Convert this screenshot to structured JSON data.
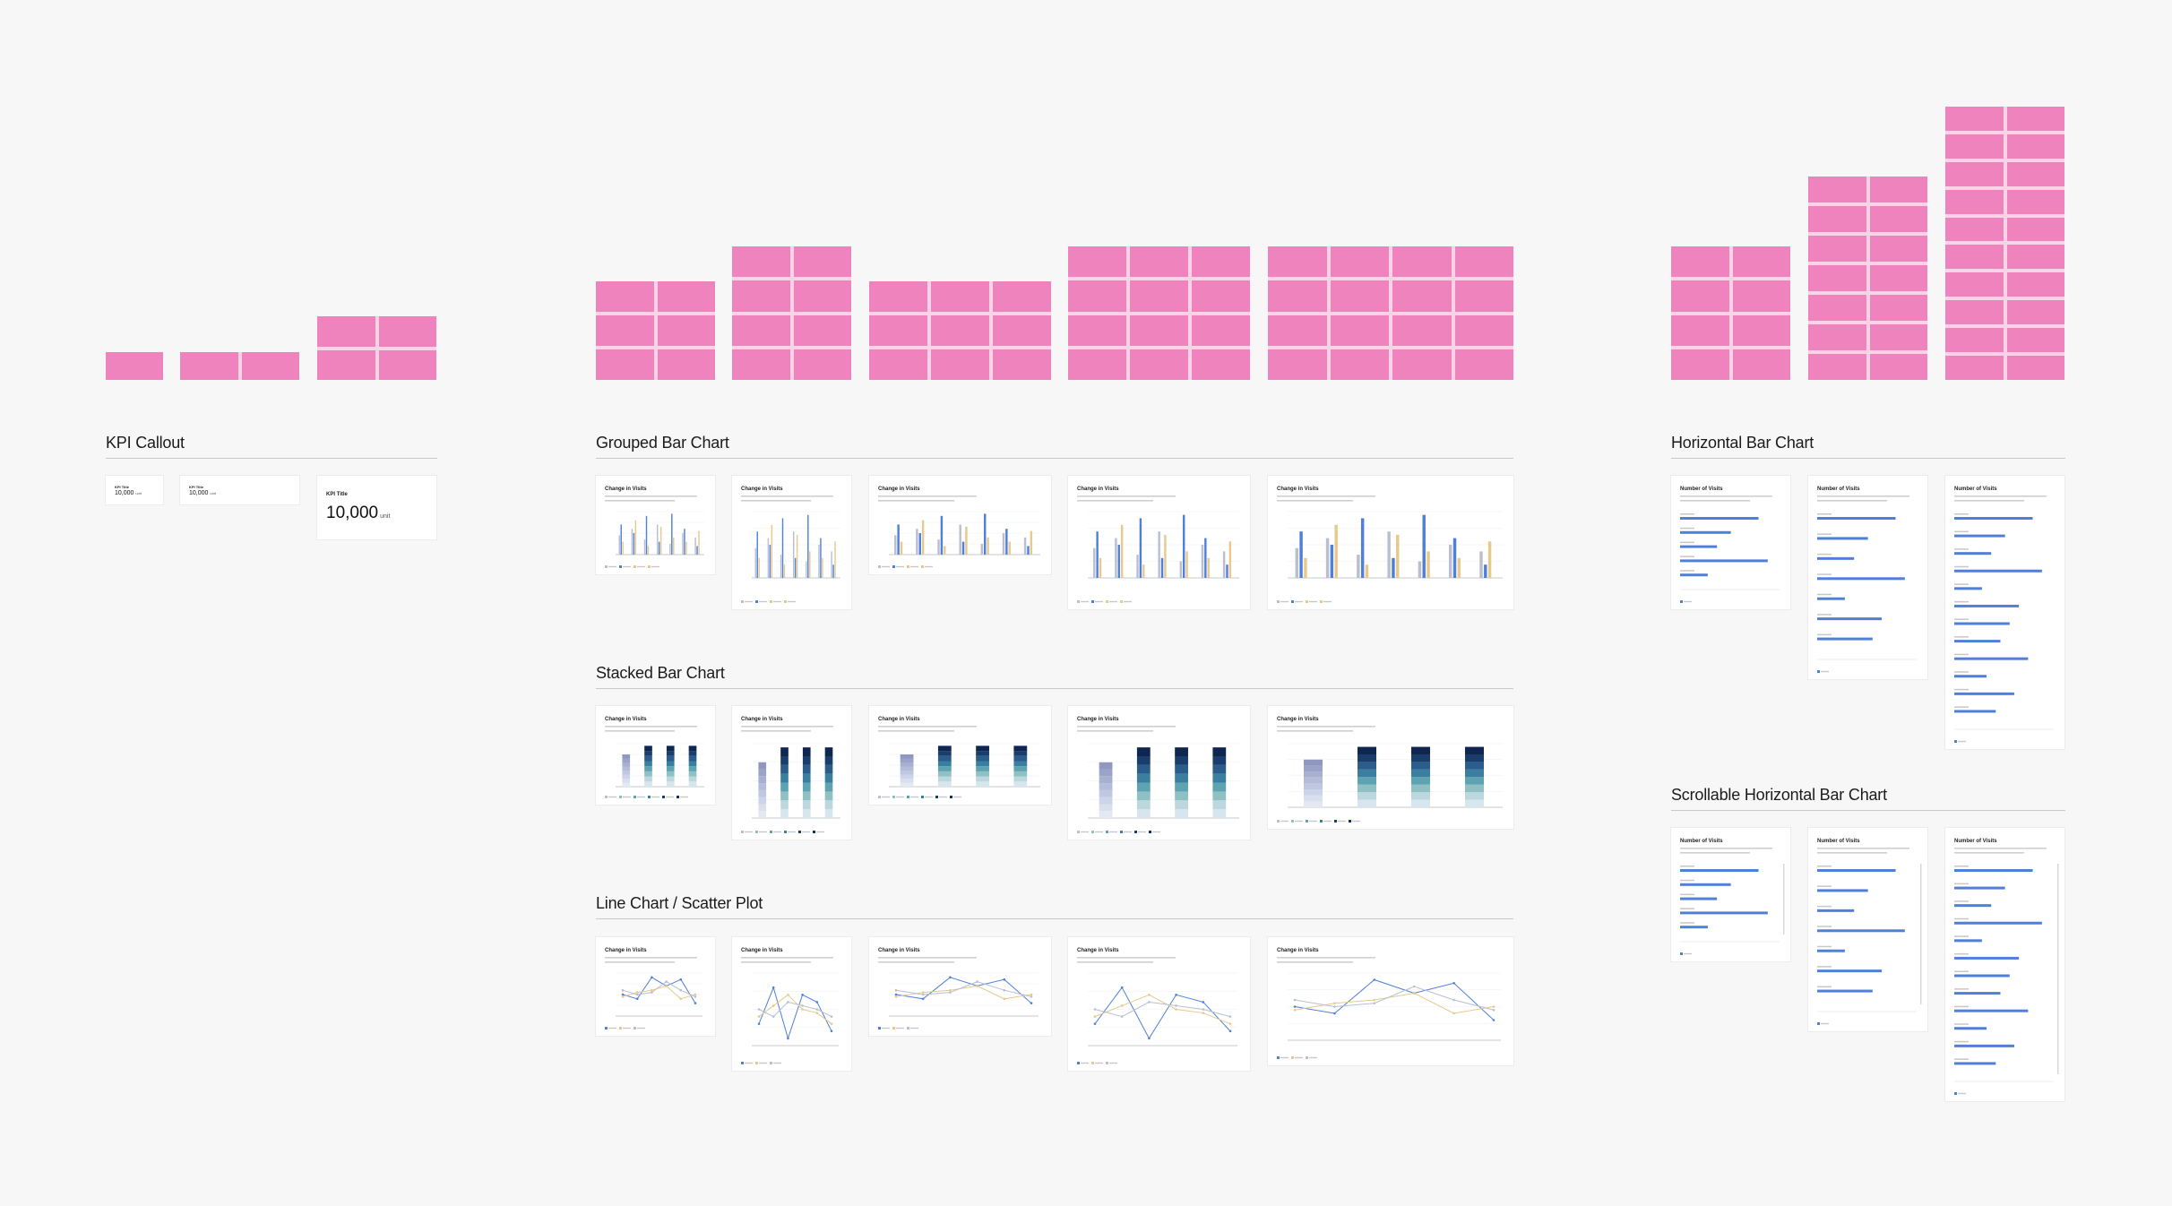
{
  "sections": {
    "kpi": "KPI Callout",
    "grouped": "Grouped Bar Chart",
    "stacked": "Stacked Bar Chart",
    "line": "Line Chart / Scatter Plot",
    "horizontal": "Horizontal Bar Chart",
    "scrollable": "Scrollable Horizontal Bar Chart"
  },
  "kpi": {
    "title": "KPI Title",
    "value": "10,000",
    "unit": "unit"
  },
  "card": {
    "change_title": "Change in Visits",
    "visits_title": "Number of Visits"
  },
  "colors": {
    "block_cell": "#ee83be",
    "block_gap": "#fbd3e7",
    "blue": "#4f7fd8",
    "gold": "#e7c98b",
    "grey": "#b9bfd0",
    "navy": "#15305e"
  }
}
